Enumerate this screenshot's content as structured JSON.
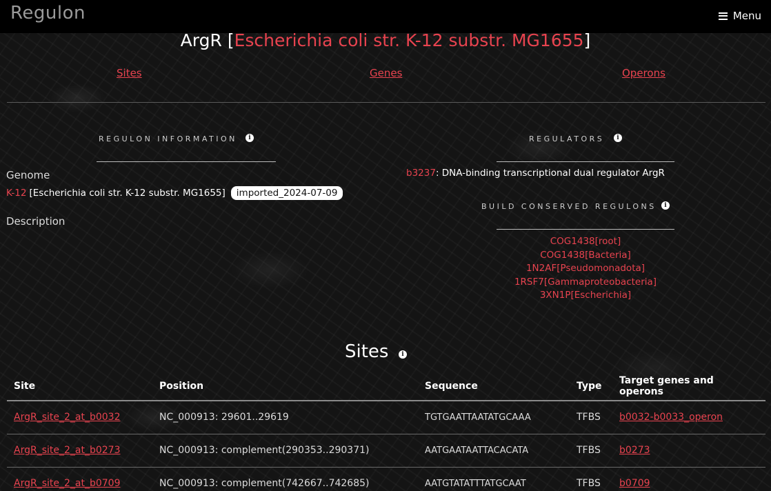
{
  "app": {
    "logo": "Regulon",
    "menu_label": "Menu"
  },
  "title": {
    "regulator": "ArgR",
    "open_bracket": "[",
    "organism": "Escherichia coli str. K-12 substr. MG1655",
    "close_bracket": "]"
  },
  "tabs": [
    {
      "label": "Sites"
    },
    {
      "label": "Genes"
    },
    {
      "label": "Operons"
    }
  ],
  "regulon_info": {
    "heading": "REGULON INFORMATION",
    "genome_label": "Genome",
    "genome_link": "K-12",
    "genome_name": "[Escherichia coli str. K-12 substr. MG1655]",
    "badge": "imported_2024-07-09",
    "description_label": "Description"
  },
  "regulators": {
    "heading": "REGULATORS",
    "gene_link": "b3237",
    "gene_desc": ": DNA-binding transcriptional dual regulator ArgR"
  },
  "conserved": {
    "heading": "BUILD CONSERVED REGULONS",
    "items": [
      "COG1438[root]",
      "COG1438[Bacteria]",
      "1N2AF[Pseudomonadota]",
      "1RSF7[Gammaproteobacteria]",
      "3XN1P[Escherichia]"
    ]
  },
  "sites": {
    "title": "Sites",
    "columns": [
      "Site",
      "Position",
      "Sequence",
      "Type",
      "Target genes and operons"
    ],
    "rows": [
      {
        "site": "ArgR_site_2_at_b0032",
        "position": "NC_000913: 29601..29619",
        "sequence": "TGTGAATTAATATGCAAA",
        "type": "TFBS",
        "target": "b0032-b0033_operon"
      },
      {
        "site": "ArgR_site_2_at_b0273",
        "position": "NC_000913: complement(290353..290371)",
        "sequence": "AATGAATAATTACACATA",
        "type": "TFBS",
        "target": "b0273"
      },
      {
        "site": "ArgR_site_2_at_b0709",
        "position": "NC_000913: complement(742667..742685)",
        "sequence": "AATGTATATTTATGCAAT",
        "type": "TFBS",
        "target": "b0709"
      }
    ]
  }
}
